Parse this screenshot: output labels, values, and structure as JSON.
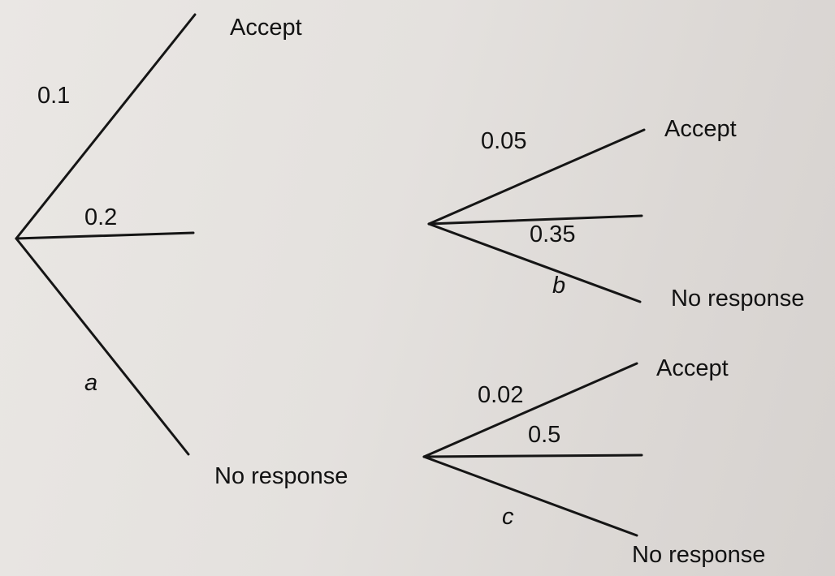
{
  "first_stage": {
    "branch_top_label": "0.1",
    "branch_middle_label": "0.2",
    "branch_bottom_label": "a",
    "outcome_top": "Accept",
    "outcome_bottom": "No response"
  },
  "second_stage_upper": {
    "branch_top_label": "0.05",
    "branch_middle_label": "0.35",
    "branch_bottom_label": "b",
    "outcome_top": "Accept",
    "outcome_bottom": "No response"
  },
  "second_stage_lower": {
    "branch_top_label": "0.02",
    "branch_middle_label": "0.5",
    "branch_bottom_label": "c",
    "outcome_top": "Accept",
    "outcome_bottom": "No response"
  }
}
